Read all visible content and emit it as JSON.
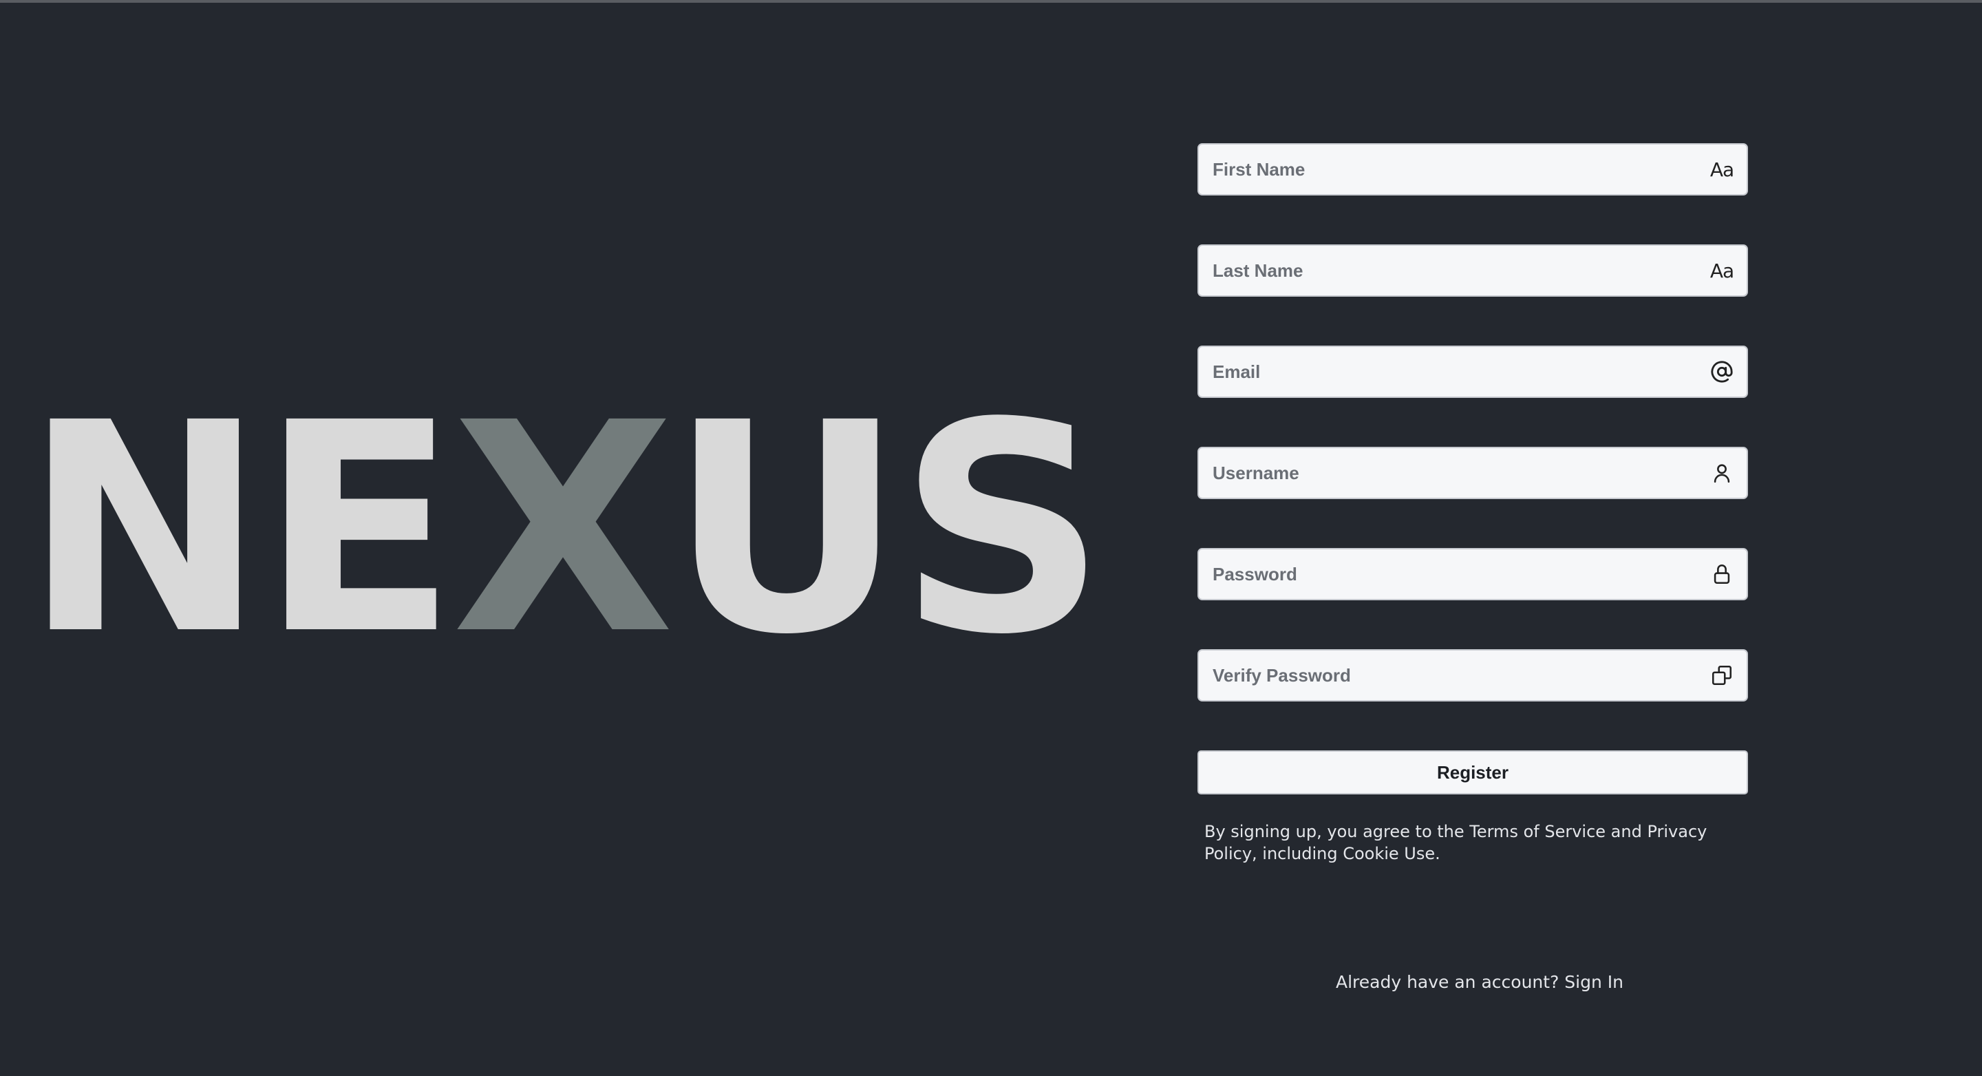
{
  "brand": {
    "letters": [
      "N",
      "E",
      "X",
      "U",
      "S"
    ],
    "accent_color": "#737c7c",
    "base_color": "#d9d9d9"
  },
  "form": {
    "fields": [
      {
        "name": "first-name",
        "placeholder": "First Name",
        "type": "text",
        "icon": "text-case-icon",
        "icon_glyph": "Aa"
      },
      {
        "name": "last-name",
        "placeholder": "Last Name",
        "type": "text",
        "icon": "text-case-icon",
        "icon_glyph": "Aa"
      },
      {
        "name": "email",
        "placeholder": "Email",
        "type": "email",
        "icon": "at-sign-icon"
      },
      {
        "name": "username",
        "placeholder": "Username",
        "type": "text",
        "icon": "user-icon"
      },
      {
        "name": "password",
        "placeholder": "Password",
        "type": "password",
        "icon": "lock-icon"
      },
      {
        "name": "verify-password",
        "placeholder": "Verify Password",
        "type": "password",
        "icon": "copy-icon"
      }
    ],
    "register_label": "Register",
    "terms_text": "By signing up, you agree to the Terms of Service and Privacy Policy, including Cookie Use.",
    "signin_prompt": "Already have an account?",
    "signin_link": "Sign In"
  },
  "colors": {
    "background": "#24282f",
    "input_bg": "#f6f7f9",
    "text_light": "#e4e6ea"
  }
}
